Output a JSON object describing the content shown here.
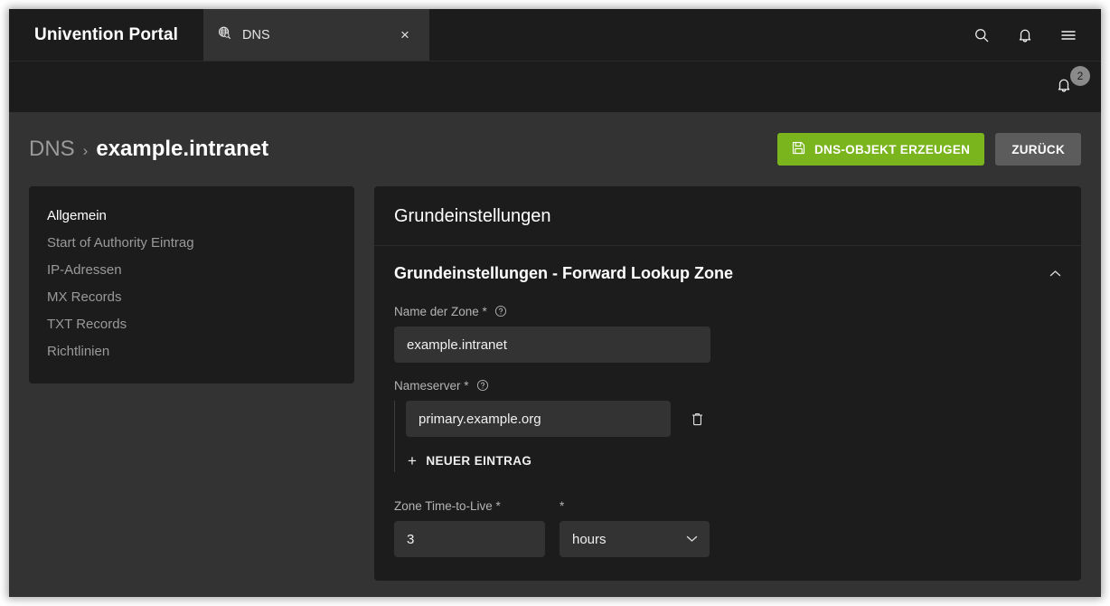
{
  "window": {
    "brand": "Univention Portal",
    "tab": {
      "label": "DNS",
      "icon": "globe-search-icon",
      "close": "×"
    },
    "header_icons": [
      {
        "name": "search-icon"
      },
      {
        "name": "bell-icon"
      },
      {
        "name": "hamburger-menu-icon"
      }
    ],
    "subbar": {
      "notification_icon": "bell-icon",
      "badge_count": "2"
    }
  },
  "page": {
    "breadcrumb": {
      "parent": "DNS",
      "separator": "›",
      "current": "example.intranet"
    },
    "actions": {
      "primary_label": "DNS-OBJEKT ERZEUGEN",
      "primary_icon": "save-floppy-icon",
      "secondary_label": "ZURÜCK"
    }
  },
  "sidebar": {
    "items": [
      {
        "label": "Allgemein",
        "active": true
      },
      {
        "label": "Start of Authority Eintrag",
        "active": false
      },
      {
        "label": "IP-Adressen",
        "active": false
      },
      {
        "label": "MX Records",
        "active": false
      },
      {
        "label": "TXT Records",
        "active": false
      },
      {
        "label": "Richtlinien",
        "active": false
      }
    ]
  },
  "panel": {
    "title": "Grundeinstellungen",
    "section": {
      "title": "Grundeinstellungen - Forward Lookup Zone",
      "collapse_icon": "chevron-up-icon"
    },
    "fields": {
      "zone_name": {
        "label": "Name der Zone *",
        "help_icon": "question-circle-icon",
        "value": "example.intranet",
        "placeholder": ""
      },
      "nameserver": {
        "label": "Nameserver *",
        "help_icon": "question-circle-icon",
        "entries": [
          {
            "value": "primary.example.org",
            "delete_icon": "trash-icon"
          }
        ],
        "add_label": "NEUER EINTRAG",
        "add_icon": "plus-icon",
        "placeholder": ""
      },
      "ttl": {
        "label": "Zone Time-to-Live *",
        "value": "3",
        "placeholder": "",
        "unit_label": "*",
        "unit_value": "hours",
        "unit_chevron": "chevron-down-icon"
      }
    }
  },
  "colors": {
    "accent_green": "#7ab51e",
    "panel_bg": "#1c1c1c",
    "page_bg": "#333333",
    "input_bg": "#333333",
    "muted_text": "#9a9a9a"
  }
}
